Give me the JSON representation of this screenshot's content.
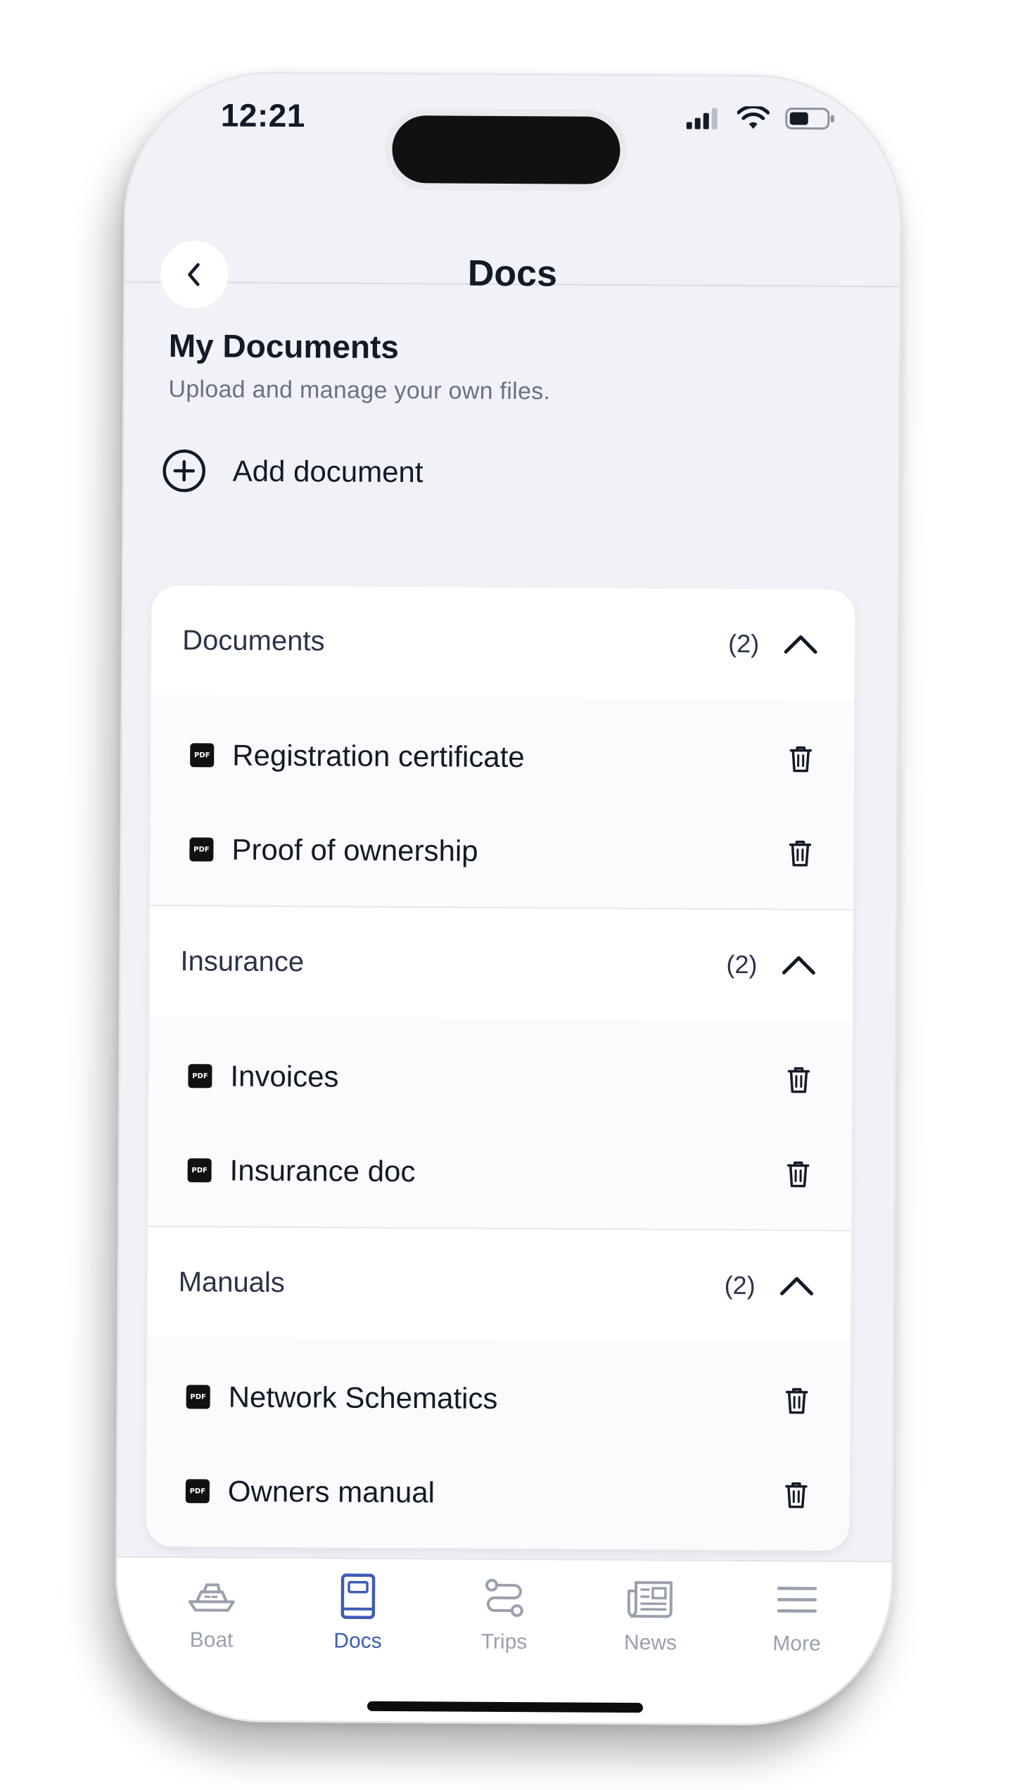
{
  "status_bar": {
    "time": "12:21"
  },
  "header": {
    "title": "Docs",
    "back_icon": "chevron-left-icon"
  },
  "my_documents": {
    "title": "My Documents",
    "subtitle": "Upload and manage your own files.",
    "add_label": "Add document"
  },
  "groups": [
    {
      "name": "Documents",
      "count": "(2)",
      "items": [
        "Registration certificate",
        "Proof of ownership"
      ]
    },
    {
      "name": "Insurance",
      "count": "(2)",
      "items": [
        "Invoices",
        "Insurance doc"
      ]
    },
    {
      "name": "Manuals",
      "count": "(2)",
      "items": [
        "Network Schematics",
        "Owners manual"
      ]
    }
  ],
  "pdf_badge": "PDF",
  "tabs": [
    {
      "label": "Boat",
      "icon": "boat-icon",
      "active": false
    },
    {
      "label": "Docs",
      "icon": "book-icon",
      "active": true
    },
    {
      "label": "Trips",
      "icon": "route-icon",
      "active": false
    },
    {
      "label": "News",
      "icon": "newspaper-icon",
      "active": false
    },
    {
      "label": "More",
      "icon": "menu-icon",
      "active": false
    }
  ],
  "colors": {
    "background": "#f1f2f7",
    "card": "#ffffff",
    "active_tab": "#3f5bb5",
    "inactive_tab": "#9aa0ad",
    "text_primary": "#121a26",
    "text_secondary": "#6b7182"
  }
}
